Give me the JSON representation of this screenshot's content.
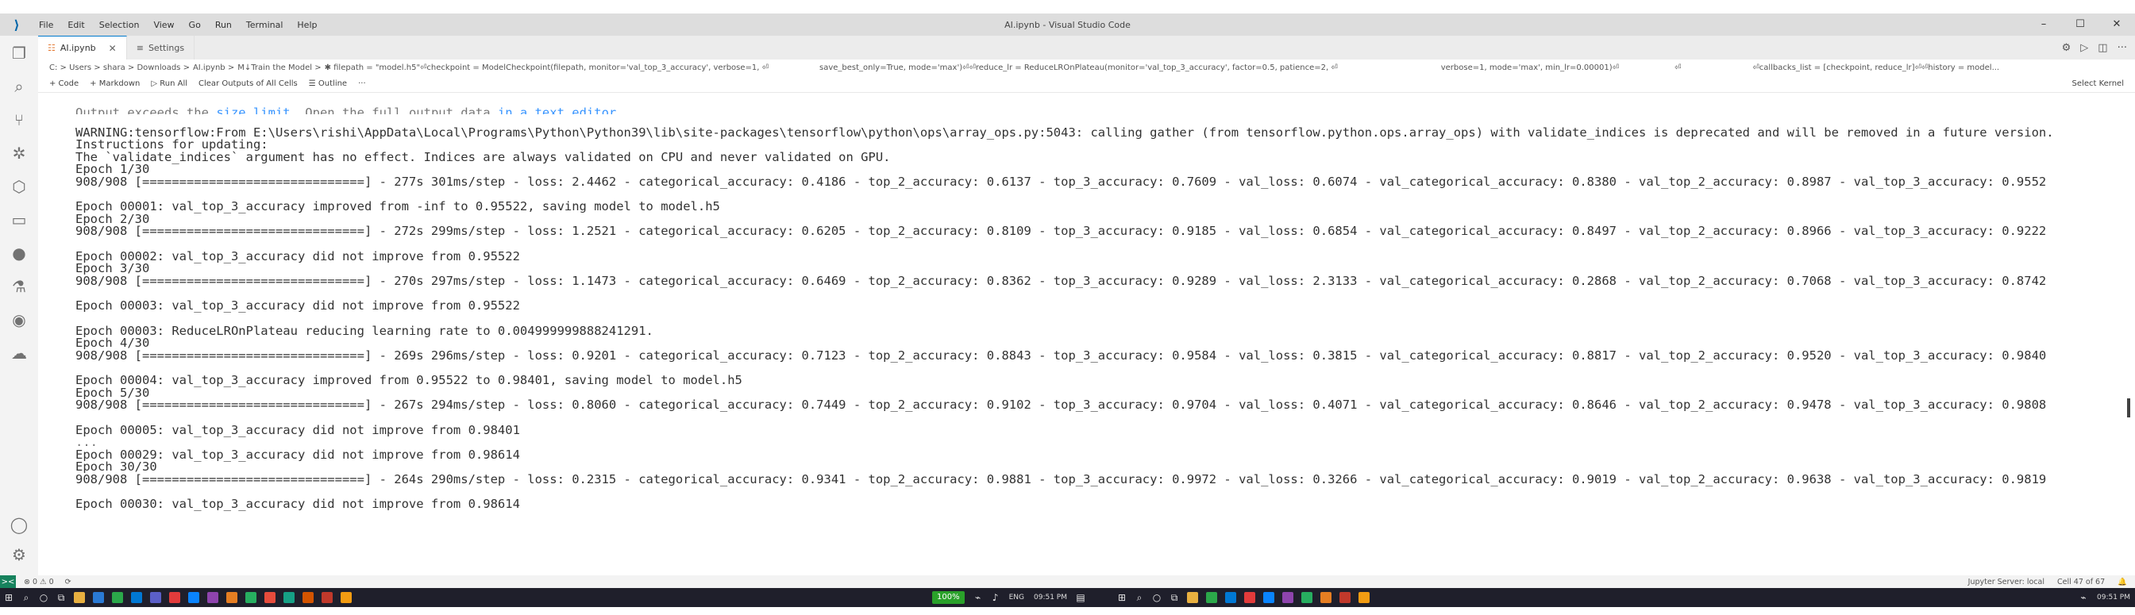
{
  "window": {
    "title": "AI.ipynb - Visual Studio Code",
    "menu": [
      "File",
      "Edit",
      "Selection",
      "View",
      "Go",
      "Run",
      "Terminal",
      "Help"
    ],
    "controls": [
      "–",
      "☐",
      "✕"
    ]
  },
  "tabs": [
    {
      "label": "AI.ipynb",
      "active": true
    },
    {
      "label": "Settings",
      "active": false
    }
  ],
  "breadcrumb": {
    "segments": [
      "C: > Users > shara > Downloads >",
      "AI.ipynb >",
      "M↓Train the Model >",
      "✱ filepath = \"model.h5\"⏎checkpoint = ModelCheckpoint(filepath, monitor='val_top_3_accuracy', verbose=1, ⏎"
    ],
    "frag2": "save_best_only=True, mode='max')⏎⏎reduce_lr = ReduceLROnPlateau(monitor='val_top_3_accuracy', factor=0.5, patience=2, ⏎",
    "frag3": "verbose=1, mode='max', min_lr=0.00001)⏎",
    "frag4": "⏎",
    "frag5": "⏎callbacks_list = [checkpoint, reduce_lr]⏎⏎history = model..."
  },
  "toolbar": {
    "code": "+ Code",
    "markdown": "+ Markdown",
    "run_all": "▷ Run All",
    "clear": "Clear Outputs of All Cells",
    "outline": "☰ Outline",
    "more": "···",
    "kernel": "Select Kernel"
  },
  "output": {
    "truncated_notice_start": "Output exceeds the ",
    "truncated_link1": "size limit",
    "truncated_mid": ". Open the full output data ",
    "truncated_link2": "in a text editor",
    "lines": [
      "WARNING:tensorflow:From E:\\Users\\rishi\\AppData\\Local\\Programs\\Python\\Python39\\lib\\site-packages\\tensorflow\\python\\ops\\array_ops.py:5043: calling gather (from tensorflow.python.ops.array_ops) with validate_indices is deprecated and will be removed in a future version.",
      "Instructions for updating:",
      "The `validate_indices` argument has no effect. Indices are always validated on CPU and never validated on GPU.",
      "Epoch 1/30",
      "908/908 [==============================] - 277s 301ms/step - loss: 2.4462 - categorical_accuracy: 0.4186 - top_2_accuracy: 0.6137 - top_3_accuracy: 0.7609 - val_loss: 0.6074 - val_categorical_accuracy: 0.8380 - val_top_2_accuracy: 0.8987 - val_top_3_accuracy: 0.9552",
      "",
      "Epoch 00001: val_top_3_accuracy improved from -inf to 0.95522, saving model to model.h5",
      "Epoch 2/30",
      "908/908 [==============================] - 272s 299ms/step - loss: 1.2521 - categorical_accuracy: 0.6205 - top_2_accuracy: 0.8109 - top_3_accuracy: 0.9185 - val_loss: 0.6854 - val_categorical_accuracy: 0.8497 - val_top_2_accuracy: 0.8966 - val_top_3_accuracy: 0.9222",
      "",
      "Epoch 00002: val_top_3_accuracy did not improve from 0.95522",
      "Epoch 3/30",
      "908/908 [==============================] - 270s 297ms/step - loss: 1.1473 - categorical_accuracy: 0.6469 - top_2_accuracy: 0.8362 - top_3_accuracy: 0.9289 - val_loss: 2.3133 - val_categorical_accuracy: 0.2868 - val_top_2_accuracy: 0.7068 - val_top_3_accuracy: 0.8742",
      "",
      "Epoch 00003: val_top_3_accuracy did not improve from 0.95522",
      "",
      "Epoch 00003: ReduceLROnPlateau reducing learning rate to 0.004999999888241291.",
      "Epoch 4/30",
      "908/908 [==============================] - 269s 296ms/step - loss: 0.9201 - categorical_accuracy: 0.7123 - top_2_accuracy: 0.8843 - top_3_accuracy: 0.9584 - val_loss: 0.3815 - val_categorical_accuracy: 0.8817 - val_top_2_accuracy: 0.9520 - val_top_3_accuracy: 0.9840",
      "",
      "Epoch 00004: val_top_3_accuracy improved from 0.95522 to 0.98401, saving model to model.h5",
      "Epoch 5/30",
      "908/908 [==============================] - 267s 294ms/step - loss: 0.8060 - categorical_accuracy: 0.7449 - top_2_accuracy: 0.9102 - top_3_accuracy: 0.9704 - val_loss: 0.4071 - val_categorical_accuracy: 0.8646 - val_top_2_accuracy: 0.9478 - val_top_3_accuracy: 0.9808",
      "",
      "Epoch 00005: val_top_3_accuracy did not improve from 0.98401",
      "...",
      "Epoch 00029: val_top_3_accuracy did not improve from 0.98614",
      "Epoch 30/30",
      "908/908 [==============================] - 264s 290ms/step - loss: 0.2315 - categorical_accuracy: 0.9341 - top_2_accuracy: 0.9881 - top_3_accuracy: 0.9972 - val_loss: 0.3266 - val_categorical_accuracy: 0.9019 - val_top_2_accuracy: 0.9638 - val_top_3_accuracy: 0.9819",
      "",
      "Epoch 00030: val_top_3_accuracy did not improve from 0.98614"
    ]
  },
  "statusbar": {
    "remote": "><",
    "problems": "⊗ 0 ⚠ 0",
    "sync": "⟳",
    "jupyter": "Jupyter Server: local",
    "cell": "Cell 47 of 67"
  },
  "taskbar": {
    "battery": "100%",
    "lang": "ENG",
    "time1": "09:51 PM",
    "time2": "09:51 PM"
  },
  "colors": {
    "accent": "#007acc",
    "link": "#3794ff",
    "remote": "#16825d",
    "taskbar": "#1f1f2b"
  }
}
